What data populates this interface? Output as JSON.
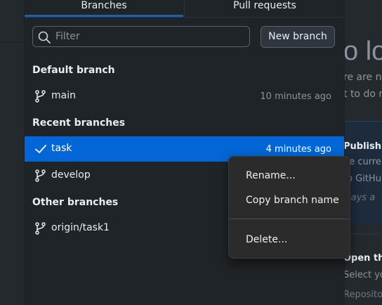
{
  "background": {
    "heading_fragment": "o lo",
    "line1": "re are no",
    "line2": "t to do m",
    "publish_title": "Publish y",
    "publish_line1": "he curre",
    "publish_line2": "to GitHu",
    "publish_line3": "ways a",
    "open_title": "Open the",
    "open_line1": "Select yo",
    "open_line2": "Reposito"
  },
  "tabs": [
    {
      "label": "Branches",
      "selected": true
    },
    {
      "label": "Pull requests",
      "selected": false
    }
  ],
  "filter": {
    "placeholder": "Filter",
    "value": ""
  },
  "new_branch_label": "New branch",
  "sections": {
    "default": "Default branch",
    "recent": "Recent branches",
    "other": "Other branches"
  },
  "branches": {
    "default": [
      {
        "name": "main",
        "time": "10 minutes ago",
        "icon": "branch-icon"
      }
    ],
    "recent": [
      {
        "name": "task",
        "time": "4 minutes ago",
        "icon": "check-icon",
        "selected": true
      },
      {
        "name": "develop",
        "time": "",
        "icon": "branch-icon"
      }
    ],
    "other": [
      {
        "name": "origin/task1",
        "time": "",
        "icon": "branch-icon"
      }
    ]
  },
  "context_menu": {
    "rename": "Rename...",
    "copy": "Copy branch name",
    "delete": "Delete..."
  },
  "colors": {
    "accent": "#0366d6",
    "panel": "#1f2428",
    "menu": "#2b2b2b"
  }
}
